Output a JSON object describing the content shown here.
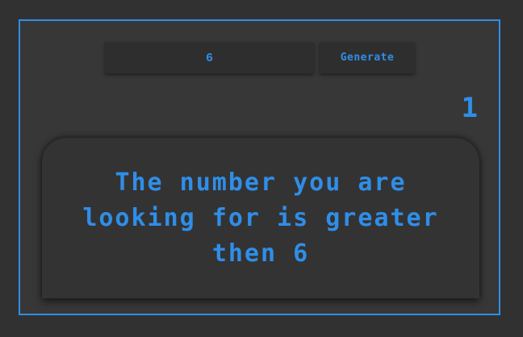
{
  "guess_input": {
    "value": "6"
  },
  "generate_button": {
    "label": "Generate"
  },
  "attempt_counter": {
    "value": "1"
  },
  "message": {
    "text": "The number you are looking for is greater then 6"
  },
  "colors": {
    "accent": "#2f8ee8",
    "background": "#313131",
    "panel": "#373737"
  }
}
